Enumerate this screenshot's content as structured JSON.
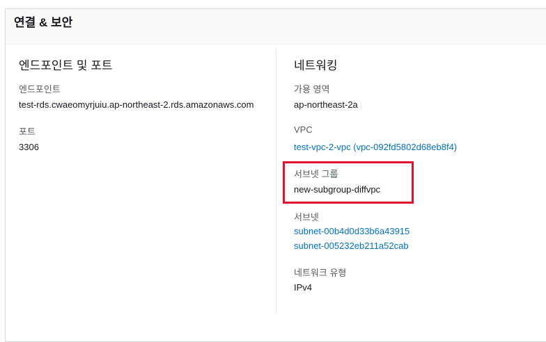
{
  "panel": {
    "title": "연결 & 보안"
  },
  "left": {
    "section_title": "엔드포인트 및 포트",
    "endpoint_label": "엔드포인트",
    "endpoint_value": "test-rds.cwaeomyrjuiu.ap-northeast-2.rds.amazonaws.com",
    "port_label": "포트",
    "port_value": "3306"
  },
  "right": {
    "section_title": "네트워킹",
    "az_label": "가용 영역",
    "az_value": "ap-northeast-2a",
    "vpc_label": "VPC",
    "vpc_value": "test-vpc-2-vpc (vpc-092fd5802d68eb8f4)",
    "subnet_group_label": "서브넷 그룹",
    "subnet_group_value": "new-subgroup-diffvpc",
    "subnets_label": "서브넷",
    "subnets": [
      "subnet-00b4d0d33b6a43915",
      "subnet-005232eb211a52cab"
    ],
    "network_type_label": "네트워크 유형",
    "network_type_value": "IPv4"
  },
  "colors": {
    "link": "#0073bb",
    "highlight": "#e0102f",
    "label": "#545b64"
  }
}
